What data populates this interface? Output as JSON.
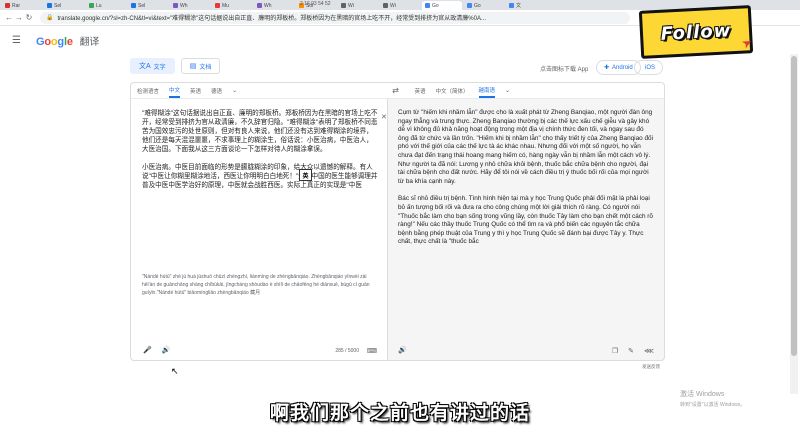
{
  "tabs": [
    {
      "label": "Rar",
      "color": "#d93025"
    },
    {
      "label": "Sel",
      "color": "#1a73e8"
    },
    {
      "label": "Lu",
      "color": "#34a853"
    },
    {
      "label": "Sel",
      "color": "#1a73e8"
    },
    {
      "label": "Wh",
      "color": "#7e57c2"
    },
    {
      "label": "Mu",
      "color": "#e53935"
    },
    {
      "label": "Wh",
      "color": "#7e57c2"
    },
    {
      "label": "Sol",
      "color": "#fb8c00"
    },
    {
      "label": "Wi",
      "color": "#5f6368"
    },
    {
      "label": "Wi",
      "color": "#5f6368"
    },
    {
      "label": "Go",
      "color": "#4285f4",
      "active": true
    },
    {
      "label": "Go",
      "color": "#4285f4"
    },
    {
      "label": "文",
      "color": "#4285f4"
    }
  ],
  "tab_center_text": "2 16 03 54 52",
  "address": {
    "url": "translate.google.cn/?sl=zh-CN&tl=vi&text=\"难得糊涂\"这句话据说出自正直、廉明的郑板桥。郑板桥因为在黑暗的官场上吃不开，经常受到排挤为官从政清廉%0A..."
  },
  "header": {
    "logo_letters": [
      "G",
      "o",
      "o",
      "g",
      "l",
      "e"
    ],
    "product": "翻译"
  },
  "modes": [
    {
      "icon": "文A",
      "label": "文字",
      "active": true
    },
    {
      "icon": "▤",
      "label": "文档",
      "active": false
    }
  ],
  "download_text": "点击图标下载 App",
  "stores": [
    {
      "icon": "✚",
      "label": "Android"
    },
    {
      "icon": "",
      "label": "iOS"
    }
  ],
  "source_langs": [
    "检测语言",
    "中文",
    "英语",
    "德语"
  ],
  "source_selected": 1,
  "target_langs": [
    "英语",
    "中文（简体）",
    "越南语"
  ],
  "target_selected": 2,
  "source_paragraphs": [
    "\"难得糊涂\"这句话据说出自正直、廉明的郑板桥。郑板桥因为在黑暗的官场上吃不开，经常受到排挤为官从政清廉，不久辞官归隐。\"难得糊涂\"表明了郑板桥不同悲苦为国效忠污的处世原则，但对有良人来说，他们还没有达到难得糊涂的境界，他们还是每天混混噩噩，不求事理上的糊涂生，俗话说：小医治病，中医治人，大医治国。下面我从这三方面谈论一下怎样对待人的糊涂拿误。",
    "小医治病。中医目前面临的形势是朦胧糊涂的印象，给大众以遗憾的解释。有人说\"中医让你糊里糊涂地活，西医让你明明白白地死！\"知果中国的医生能够调理并普及中医中医学治好的原理，中医就会战胜西医。实际上真正的实现是\"中医",
    ""
  ],
  "source_roman": "\"Nándé hútú\" zhè jù huà jùshuō chūzì zhèngzhí, liánmíng de zhèngbǎnqiáo. Zhèngbǎnqiáo yīnwèi zài hēi'àn de guānchǎng shàng chībùkāi, jīngcháng shòudào è shìlì de chāofēng hé diànxuē, búgǔ cí guān guīyǐn.\"Nándé hútú\" biǎomíngliǎo zhèngbǎnqiáo 藏月",
  "ime_char": "英",
  "char_count": "285 / 5000",
  "target_paragraphs": [
    "Cụm từ \"hiếm khi nhầm lẫn\" được cho là xuất phát từ Zheng Banqiao, một người đàn ông ngay thẳng và trung thực. Zheng Banqiao thường bị các thế lực xấu chế giễu và gây khó dễ vì không đủ khả năng hoạt động trong một địa vị chính thức đen tối, và ngay sau đó ông đã từ chức và lần trốn. \"Hiếm khi bị nhầm lẫn\" cho thấy triết lý của Zheng Banqiao đối phó với thế giới của các thế lực tà ác khác nhau. Nhưng đối với một số người, họ vẫn chưa đạt đến trạng thái hoang mang hiếm có, hàng ngày vẫn bị nhầm lẫn một cách vô lý. Như người ta đã nói: Lương y nhỏ chữa khỏi bệnh, thuốc bắc chữa bệnh cho người, đại tài chữa bệnh cho đất nước. Hãy để tôi nói về cách điều trị ý thuốc bối rối của mọi người từ ba khía cạnh này.",
    "Bác sĩ nhỏ điều trị bệnh. Tình hình hiện tại mà y học Trung Quốc phải đối mặt là phải loại bỏ ấn tượng bối rối và đưa ra cho công chúng một lời giải thích rõ ràng. Có người nói \"Thuốc bắc làm cho bạn sống trong vũng lầy, còn thuốc Tây làm cho bạn chết một cách rõ ràng!\" Nếu các thầy thuốc Trung Quốc có thể tìm ra và phổ biến các nguyên tắc chữa bệnh bằng phép thuật của Trung y thì y học Trung Quốc sẽ đánh bại được Tây y. Thực chất, thực chất là \"thuốc bắc"
  ],
  "feedback_text": "发送反馈",
  "sticker_text": "Follow",
  "watermark": {
    "line1": "激活 Windows",
    "line2": "转到\"设置\"以激活 Windows。"
  },
  "subtitle": "啊我们那个之前也有讲过的话"
}
